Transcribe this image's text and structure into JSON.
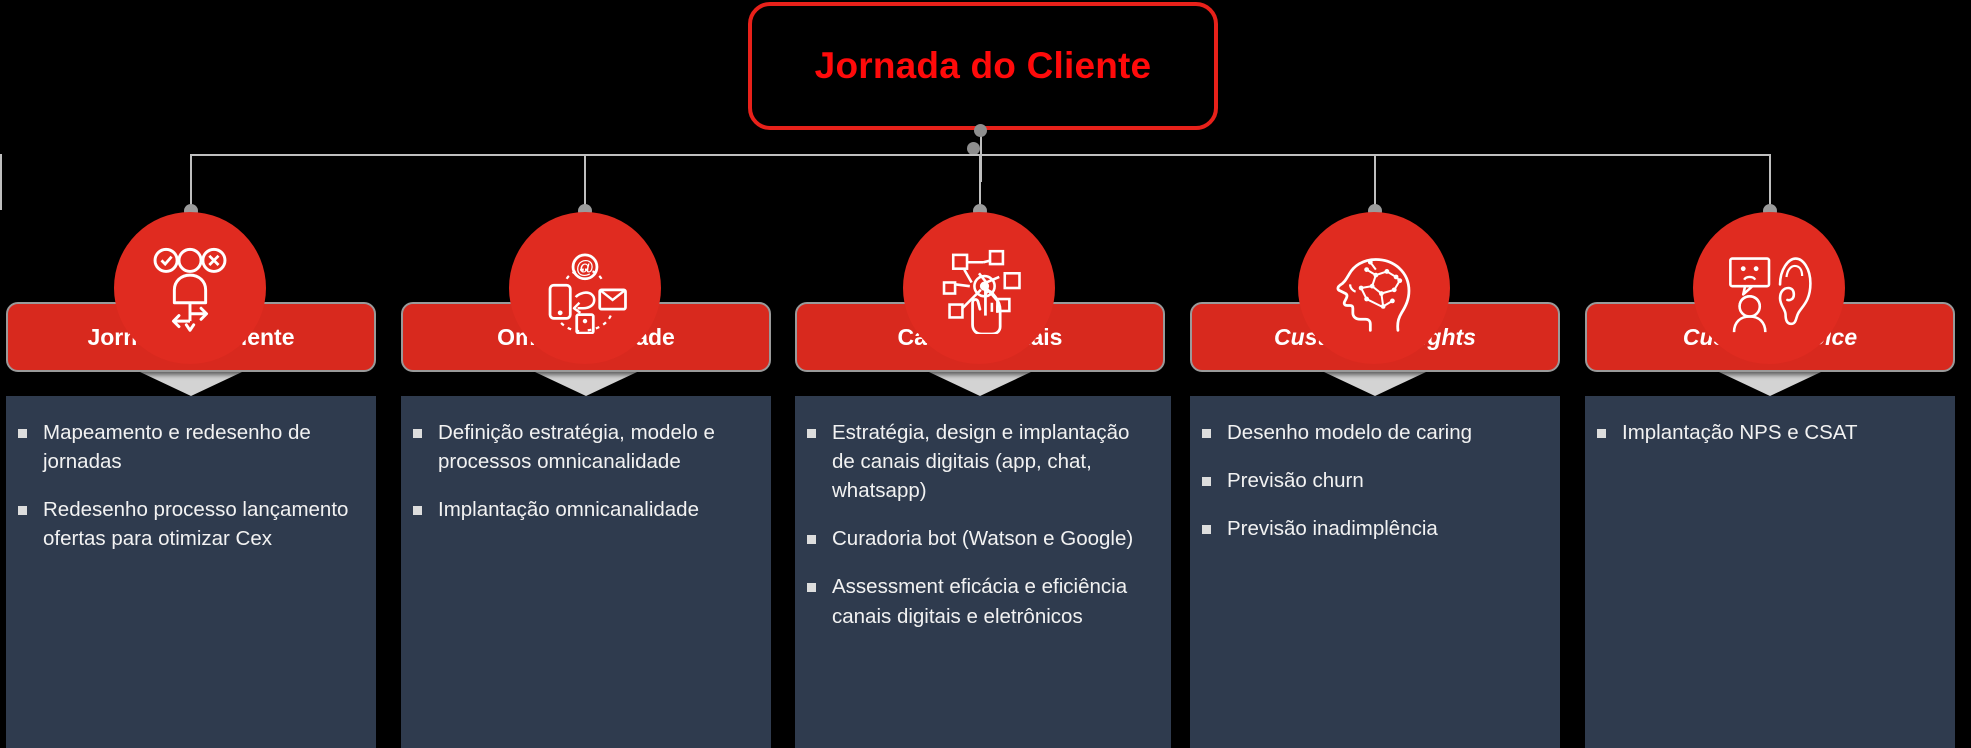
{
  "diagram": {
    "title": "Jornada do Cliente",
    "title_color": "#FF0A0A",
    "accent_color": "#D8291E",
    "panel_color": "#2F3B4E",
    "connector_color": "#BFBFBF",
    "background_color": "#000000"
  },
  "columns": [
    {
      "id": "jornada-do-cliente",
      "header": "Jornada do Cliente",
      "header_style": "bold",
      "icon": "person-approve-reject-flow-icon",
      "bullets": [
        "Mapeamento e redesenho de jornadas",
        "Redesenho processo lançamento ofertas para otimizar Cex"
      ]
    },
    {
      "id": "omnicanalidade",
      "header": "Omnicanalidade",
      "header_style": "bold",
      "icon": "multichannel-phone-email-icon",
      "bullets": [
        "Definição estratégia, modelo e processos omnicanalidade",
        "Implantação omnicanalidade"
      ]
    },
    {
      "id": "canais-digitais",
      "header": "Canais Digitais",
      "header_style": "bold",
      "icon": "hand-touch-network-icon",
      "bullets": [
        "Estratégia, design e implantação de canais digitais (app, chat, whatsapp)",
        "Curadoria bot (Watson e Google)",
        "Assessment eficácia e eficiência canais digitais e eletrônicos"
      ]
    },
    {
      "id": "customer-insights",
      "header": "Customer Insights",
      "header_style": "bold-italic",
      "icon": "brain-neural-network-icon",
      "bullets": [
        "Desenho modelo de caring",
        "Previsão churn",
        "Previsão inadimplência"
      ]
    },
    {
      "id": "customer-voice",
      "header": "Customer Voice",
      "header_style": "bold-italic",
      "icon": "feedback-ear-listening-icon",
      "bullets": [
        "Implantação NPS e CSAT"
      ]
    }
  ]
}
